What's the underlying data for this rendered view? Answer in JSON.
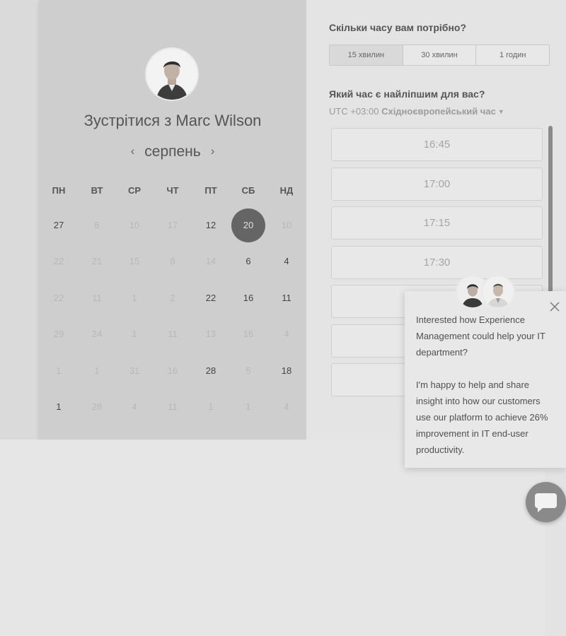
{
  "scheduler": {
    "title_prefix": "Зустрітися з ",
    "host_name": "Marc Wilson",
    "month": "серпень",
    "prev_icon": "chevron-left-icon",
    "next_icon": "chevron-right-icon",
    "weekdays": [
      "ПН",
      "ВТ",
      "СР",
      "ЧТ",
      "ПТ",
      "СБ",
      "НД"
    ],
    "weeks": [
      [
        {
          "d": "27",
          "s": "a"
        },
        {
          "d": "6",
          "s": "m"
        },
        {
          "d": "10",
          "s": "m"
        },
        {
          "d": "17",
          "s": "m"
        },
        {
          "d": "12",
          "s": "a"
        },
        {
          "d": "20",
          "s": "sel"
        },
        {
          "d": "10",
          "s": "m"
        }
      ],
      [
        {
          "d": "22",
          "s": "m"
        },
        {
          "d": "21",
          "s": "m"
        },
        {
          "d": "15",
          "s": "m"
        },
        {
          "d": "8",
          "s": "m"
        },
        {
          "d": "14",
          "s": "m"
        },
        {
          "d": "6",
          "s": "a"
        },
        {
          "d": "4",
          "s": "a"
        }
      ],
      [
        {
          "d": "22",
          "s": "m"
        },
        {
          "d": "11",
          "s": "m"
        },
        {
          "d": "1",
          "s": "m"
        },
        {
          "d": "2",
          "s": "m"
        },
        {
          "d": "22",
          "s": "a"
        },
        {
          "d": "16",
          "s": "a"
        },
        {
          "d": "11",
          "s": "a"
        }
      ],
      [
        {
          "d": "29",
          "s": "m"
        },
        {
          "d": "24",
          "s": "m"
        },
        {
          "d": "1",
          "s": "m"
        },
        {
          "d": "11",
          "s": "m"
        },
        {
          "d": "13",
          "s": "m"
        },
        {
          "d": "16",
          "s": "m"
        },
        {
          "d": "4",
          "s": "m"
        }
      ],
      [
        {
          "d": "1",
          "s": "m"
        },
        {
          "d": "1",
          "s": "m"
        },
        {
          "d": "31",
          "s": "m"
        },
        {
          "d": "16",
          "s": "m"
        },
        {
          "d": "28",
          "s": "a"
        },
        {
          "d": "5",
          "s": "m"
        },
        {
          "d": "18",
          "s": "a"
        }
      ],
      [
        {
          "d": "1",
          "s": "a"
        },
        {
          "d": "28",
          "s": "m"
        },
        {
          "d": "4",
          "s": "m"
        },
        {
          "d": "11",
          "s": "m"
        },
        {
          "d": "1",
          "s": "m"
        },
        {
          "d": "1",
          "s": "m"
        },
        {
          "d": "4",
          "s": "m"
        }
      ]
    ]
  },
  "booking": {
    "duration_question": "Скільки часу вам потрібно?",
    "durations": [
      "15 хвилин",
      "30 хвилин",
      "1 годин"
    ],
    "selected_duration": 0,
    "time_question": "Який час є найліпшим для вас?",
    "timezone_offset": "UTC +03:00",
    "timezone_name": "Східноєвропейський час",
    "timezone_caret": "▼",
    "slots": [
      "16:45",
      "17:00",
      "17:15",
      "17:30",
      "",
      "",
      ""
    ]
  },
  "chat": {
    "message_1": "Interested how Experience Management could help your IT department?",
    "message_2": "I'm happy to help and share insight into how our customers use our platform to achieve 26% improvement in IT end-user productivity.",
    "close_icon": "close-icon",
    "launcher_icon": "chat-bubble-icon"
  },
  "colors": {
    "selected_day": "#656565",
    "scrollbar": "#8a8a8a",
    "chat_launcher": "#8a8a8a"
  }
}
